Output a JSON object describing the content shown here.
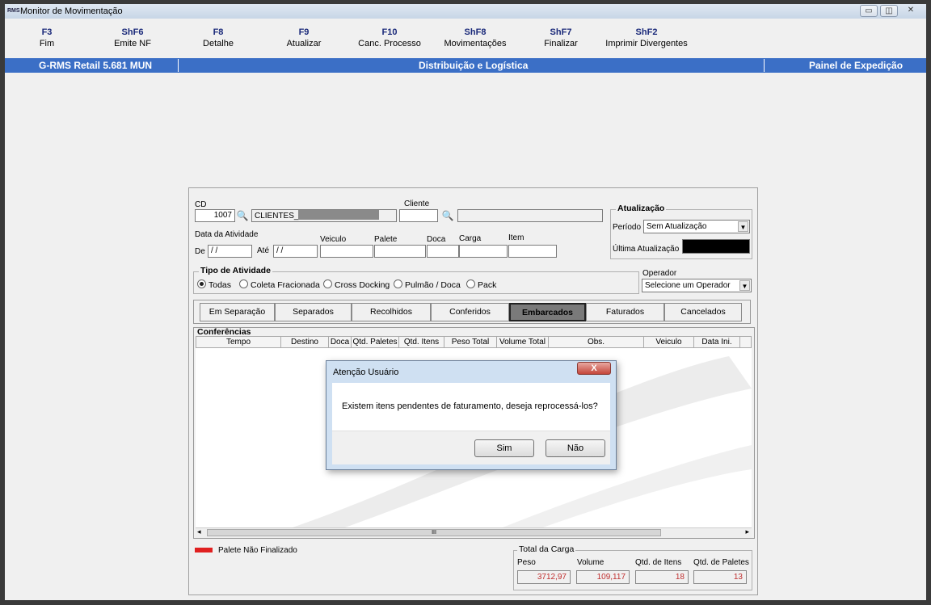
{
  "window": {
    "title": "Monitor de Movimentação",
    "app_icon_text": "RMS"
  },
  "window_controls": {
    "minimize": "▭",
    "restore": "◫",
    "close": "✕"
  },
  "fkeys": [
    {
      "key": "F3",
      "label": "Fim"
    },
    {
      "key": "ShF6",
      "label": "Emite NF"
    },
    {
      "key": "F8",
      "label": "Detalhe"
    },
    {
      "key": "F9",
      "label": "Atualizar"
    },
    {
      "key": "F10",
      "label": "Canc. Processo"
    },
    {
      "key": "ShF8",
      "label": "Movimentações"
    },
    {
      "key": "ShF7",
      "label": "Finalizar"
    },
    {
      "key": "ShF2",
      "label": "Imprimir Divergentes"
    }
  ],
  "bluebar": {
    "left": "G-RMS Retail 5.681 MUN",
    "center": "Distribuição e Logística",
    "right": "Painel de Expedição"
  },
  "filters": {
    "cd_label": "CD",
    "cd_value": "1007",
    "cd_name": "CLIENTES_",
    "cliente_label": "Cliente",
    "cliente_value": "",
    "cliente_name": "",
    "data_label": "Data da Atividade",
    "de_label": "De",
    "de_value": " / /",
    "ate_label": "Até",
    "ate_value": " / /",
    "veiculo_label": "Veiculo",
    "palete_label": "Palete",
    "doca_label": "Doca",
    "carga_label": "Carga",
    "item_label": "Item"
  },
  "atualizacao": {
    "title": "Atualização",
    "periodo_label": "Período",
    "periodo_value": "Sem Atualização",
    "ultima_label": "Última Atualização",
    "ultima_value": ""
  },
  "tipo": {
    "title": "Tipo de Atividade",
    "options": [
      "Todas",
      "Coleta Fracionada",
      "Cross Docking",
      "Pulmão / Doca",
      "Pack"
    ],
    "selected": "Todas"
  },
  "operador": {
    "label": "Operador",
    "value": "Selecione um Operador"
  },
  "tabs": [
    "Em Separação",
    "Separados",
    "Recolhidos",
    "Conferidos",
    "Embarcados",
    "Faturados",
    "Cancelados"
  ],
  "active_tab": "Embarcados",
  "conferencias": {
    "title": "Conferências",
    "columns": [
      "Tempo",
      "Destino",
      "Doca",
      "Qtd. Paletes",
      "Qtd. Itens",
      "Peso Total",
      "Volume Total",
      "Obs.",
      "Veiculo",
      "Data Ini."
    ]
  },
  "scroll": {
    "left_arrow": "◂",
    "right_arrow": "▸",
    "thumb": "III"
  },
  "legend": {
    "color": "#e02020",
    "label": "Palete Não Finalizado"
  },
  "totais": {
    "title": "Total da Carga",
    "peso_label": "Peso",
    "peso": "3712,97",
    "volume_label": "Volume",
    "volume": "109,117",
    "itens_label": "Qtd. de Itens",
    "itens": "18",
    "paletes_label": "Qtd. de Paletes",
    "paletes": "13"
  },
  "dialog": {
    "title": "Atenção Usuário",
    "close": "X",
    "message": "Existem itens pendentes de faturamento, deseja reprocessá-los?",
    "yes": "Sim",
    "no": "Não"
  },
  "colors": {
    "bluebar": "#3b6fc6",
    "fkey": "#1b2a7a",
    "total_value": "#c03030"
  }
}
